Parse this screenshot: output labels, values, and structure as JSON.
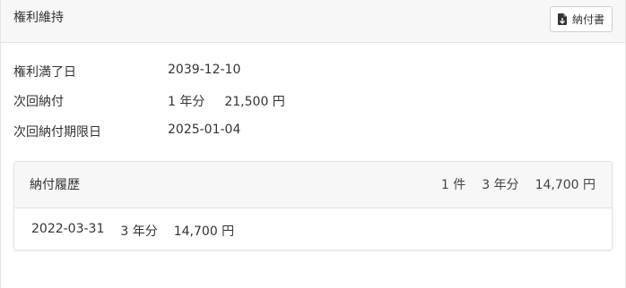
{
  "panel": {
    "title": "権利維持",
    "doc_button_label": "納付書",
    "doc_icon": "file-icon"
  },
  "info": [
    {
      "label": "権利満了日",
      "value": "2039-12-10"
    },
    {
      "label": "次回納付",
      "years": "1 年分",
      "amount": "21,500 円"
    },
    {
      "label": "次回納付期限日",
      "value": "2025-01-04"
    }
  ],
  "history": {
    "title": "納付履歴",
    "summary": {
      "count": "1 件",
      "years": "3 年分",
      "amount": "14,700 円"
    },
    "rows": [
      {
        "date": "2022-03-31",
        "years": "3 年分",
        "amount": "14,700 円"
      }
    ]
  }
}
